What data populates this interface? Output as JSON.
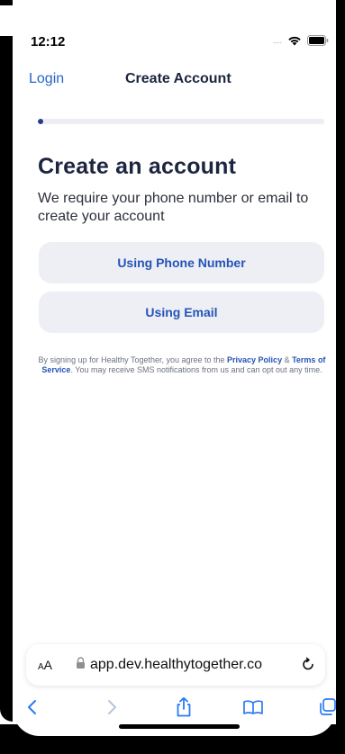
{
  "status_bar": {
    "time": "12:12",
    "signal_dots": "....",
    "icons": [
      "wifi-icon",
      "battery-icon"
    ]
  },
  "nav": {
    "back_label": "Login",
    "title": "Create Account"
  },
  "progress": {
    "value_fraction": 0.02,
    "fill_color": "#233a8c",
    "track_color": "#edeef2"
  },
  "content": {
    "title": "Create an account",
    "subtitle": "We require your phone number or email to create your account",
    "phone_button_label": "Using Phone Number",
    "email_button_label": "Using Email"
  },
  "legal": {
    "prefix": "By signing up for Healthy Together, you agree to the ",
    "privacy_link": "Privacy Policy",
    "amp": " & ",
    "terms_link": "Terms of Service",
    "suffix": ". You may receive SMS notifications from us and can opt out any time."
  },
  "browser": {
    "text_size_label_small": "A",
    "text_size_label_large": "A",
    "url": "app.dev.healthytogether.co",
    "toolbar_icons": [
      "back-icon",
      "forward-icon",
      "share-icon",
      "bookmarks-icon",
      "tabs-icon"
    ]
  },
  "colors": {
    "accent": "#2453b8",
    "title": "#1c2540",
    "button_bg": "#eeeff4"
  }
}
